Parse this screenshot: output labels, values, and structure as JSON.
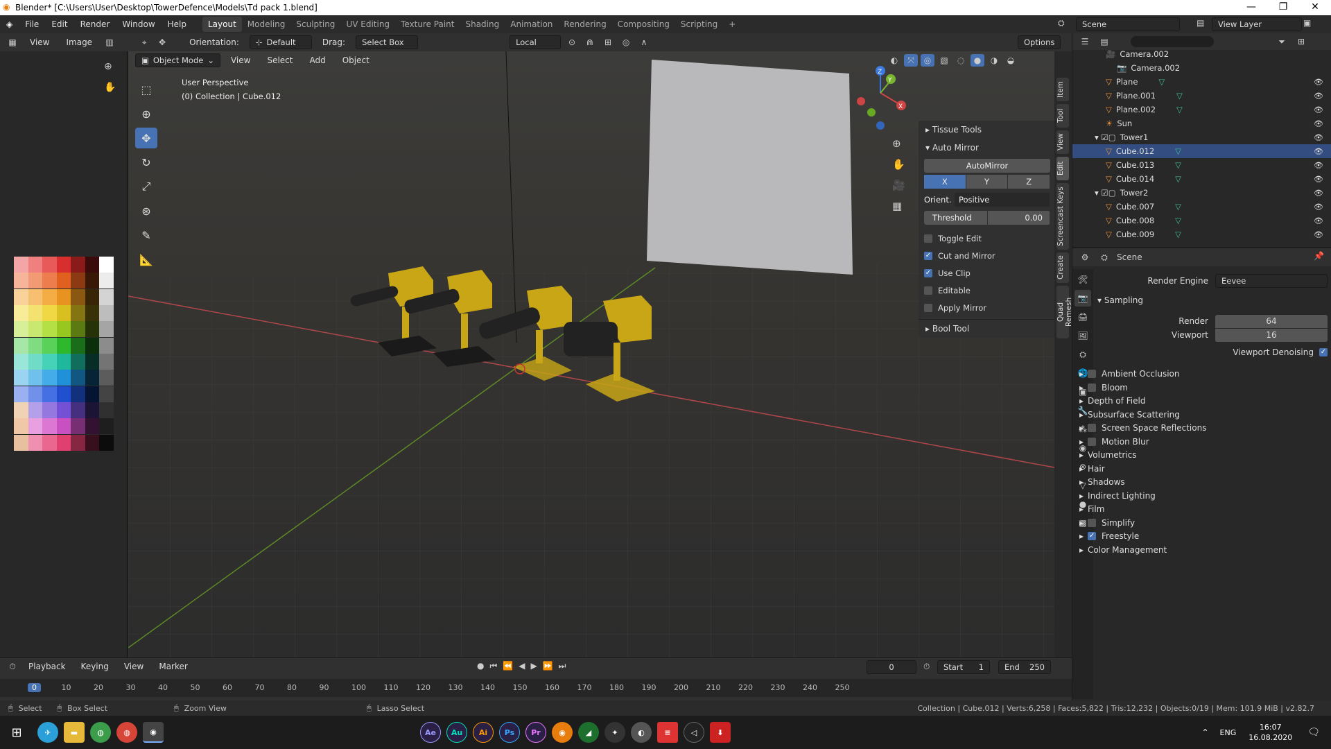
{
  "window": {
    "title": "Blender* [C:\\Users\\User\\Desktop\\TowerDefence\\Models\\Td pack 1.blend]",
    "minimize": "—",
    "restore": "❐",
    "close": "✕"
  },
  "menus": [
    "File",
    "Edit",
    "Render",
    "Window",
    "Help"
  ],
  "workspaces": [
    "Layout",
    "Modeling",
    "Sculpting",
    "UV Editing",
    "Texture Paint",
    "Shading",
    "Animation",
    "Rendering",
    "Compositing",
    "Scripting"
  ],
  "workspace_add": "+",
  "scene_field": "Scene",
  "view_layer_field": "View Layer",
  "toolheader": {
    "view": "View",
    "image": "Image",
    "orientation_label": "Orientation:",
    "orientation_value": "Default",
    "drag_label": "Drag:",
    "drag_value": "Select Box",
    "transform_pivot": "Local",
    "options": "Options"
  },
  "viewport": {
    "mode": "Object Mode",
    "menus": [
      "View",
      "Select",
      "Add",
      "Object"
    ],
    "info_line1": "User Perspective",
    "info_line2": "(0) Collection | Cube.012",
    "gizmo": {
      "x": "X",
      "y": "Y",
      "z": "Z"
    }
  },
  "npanel": {
    "tissue_tools": "Tissue Tools",
    "auto_mirror": "Auto Mirror",
    "automirror_button": "AutoMirror",
    "axes": [
      "X",
      "Y",
      "Z"
    ],
    "orient_label": "Orient.",
    "orient_value": "Positive",
    "threshold_label": "Threshold",
    "threshold_value": "0.00",
    "checks": [
      {
        "label": "Toggle Edit",
        "checked": false
      },
      {
        "label": "Cut and Mirror",
        "checked": true
      },
      {
        "label": "Use Clip",
        "checked": true
      },
      {
        "label": "Editable",
        "checked": false
      },
      {
        "label": "Apply Mirror",
        "checked": false
      }
    ],
    "bool_tool": "Bool Tool",
    "side_tabs": [
      "Item",
      "Tool",
      "View",
      "Edit",
      "Screencast Keys",
      "Create",
      "Quad Remesh"
    ]
  },
  "outliner": {
    "rows": [
      {
        "name": "Camera.002",
        "indent": 3,
        "icon": "camera-icon",
        "eye": false
      },
      {
        "name": "Camera.002",
        "indent": 4,
        "icon": "camera-data-icon",
        "eye": false
      },
      {
        "name": "Plane",
        "indent": 3,
        "icon": "mesh-icon",
        "eye": true
      },
      {
        "name": "Plane.001",
        "indent": 3,
        "icon": "mesh-icon",
        "eye": true
      },
      {
        "name": "Plane.002",
        "indent": 3,
        "icon": "mesh-icon",
        "eye": true
      },
      {
        "name": "Sun",
        "indent": 3,
        "icon": "light-icon",
        "eye": true
      },
      {
        "name": "Tower1",
        "indent": 2,
        "icon": "collection-icon",
        "eye": true
      },
      {
        "name": "Cube.012",
        "indent": 3,
        "icon": "mesh-icon",
        "eye": true
      },
      {
        "name": "Cube.013",
        "indent": 3,
        "icon": "mesh-icon",
        "eye": true
      },
      {
        "name": "Cube.014",
        "indent": 3,
        "icon": "mesh-icon",
        "eye": true
      },
      {
        "name": "Tower2",
        "indent": 2,
        "icon": "collection-icon",
        "eye": true
      },
      {
        "name": "Cube.007",
        "indent": 3,
        "icon": "mesh-icon",
        "eye": true
      },
      {
        "name": "Cube.008",
        "indent": 3,
        "icon": "mesh-icon",
        "eye": true
      },
      {
        "name": "Cube.009",
        "indent": 3,
        "icon": "mesh-icon",
        "eye": true
      }
    ]
  },
  "properties": {
    "context": "Scene",
    "render_engine_label": "Render Engine",
    "render_engine_value": "Eevee",
    "sampling": "Sampling",
    "render_label": "Render",
    "render_value": "64",
    "viewport_label": "Viewport",
    "viewport_value": "16",
    "viewport_denoising": "Viewport Denoising",
    "sections": [
      {
        "label": "Ambient Occlusion",
        "checkbox": true,
        "checked": false
      },
      {
        "label": "Bloom",
        "checkbox": true,
        "checked": false
      },
      {
        "label": "Depth of Field",
        "checkbox": false,
        "checked": false
      },
      {
        "label": "Subsurface Scattering",
        "checkbox": false,
        "checked": false
      },
      {
        "label": "Screen Space Reflections",
        "checkbox": true,
        "checked": false
      },
      {
        "label": "Motion Blur",
        "checkbox": true,
        "checked": false
      },
      {
        "label": "Volumetrics",
        "checkbox": false,
        "checked": false
      },
      {
        "label": "Hair",
        "checkbox": false,
        "checked": false
      },
      {
        "label": "Shadows",
        "checkbox": false,
        "checked": false
      },
      {
        "label": "Indirect Lighting",
        "checkbox": false,
        "checked": false
      },
      {
        "label": "Film",
        "checkbox": false,
        "checked": false
      },
      {
        "label": "Simplify",
        "checkbox": true,
        "checked": false
      },
      {
        "label": "Freestyle",
        "checkbox": true,
        "checked": true
      },
      {
        "label": "Color Management",
        "checkbox": false,
        "checked": false
      }
    ]
  },
  "timeline": {
    "menus": [
      "Playback",
      "Keying",
      "View",
      "Marker"
    ],
    "current_frame": "0",
    "start_label": "Start",
    "start_value": "1",
    "end_label": "End",
    "end_value": "250",
    "ruler": [
      "0",
      "10",
      "20",
      "30",
      "40",
      "50",
      "60",
      "70",
      "80",
      "90",
      "100",
      "110",
      "120",
      "130",
      "140",
      "150",
      "160",
      "170",
      "180",
      "190",
      "200",
      "210",
      "220",
      "230",
      "240",
      "250"
    ]
  },
  "statusbar": {
    "select": "Select",
    "box_select": "Box Select",
    "zoom_view": "Zoom View",
    "lasso_select": "Lasso Select",
    "stats": "Collection | Cube.012 | Verts:6,258 | Faces:5,822 | Tris:12,232 | Objects:0/19 | Mem: 101.9 MiB | v2.82.7"
  },
  "taskbar": {
    "apps": [
      {
        "label": "Ae",
        "color": "#9999ff"
      },
      {
        "label": "Au",
        "color": "#00e4bb"
      },
      {
        "label": "Ai",
        "color": "#ff9a00"
      },
      {
        "label": "Ps",
        "color": "#31a8ff"
      },
      {
        "label": "Pr",
        "color": "#ea77ff"
      }
    ],
    "lang": "ENG",
    "time": "16:07",
    "date": "16.08.2020"
  },
  "colors": {
    "accent": "#4772b3",
    "gold": "#c8a615",
    "x_axis": "#c54a4a",
    "y_axis": "#6a9a2a"
  }
}
